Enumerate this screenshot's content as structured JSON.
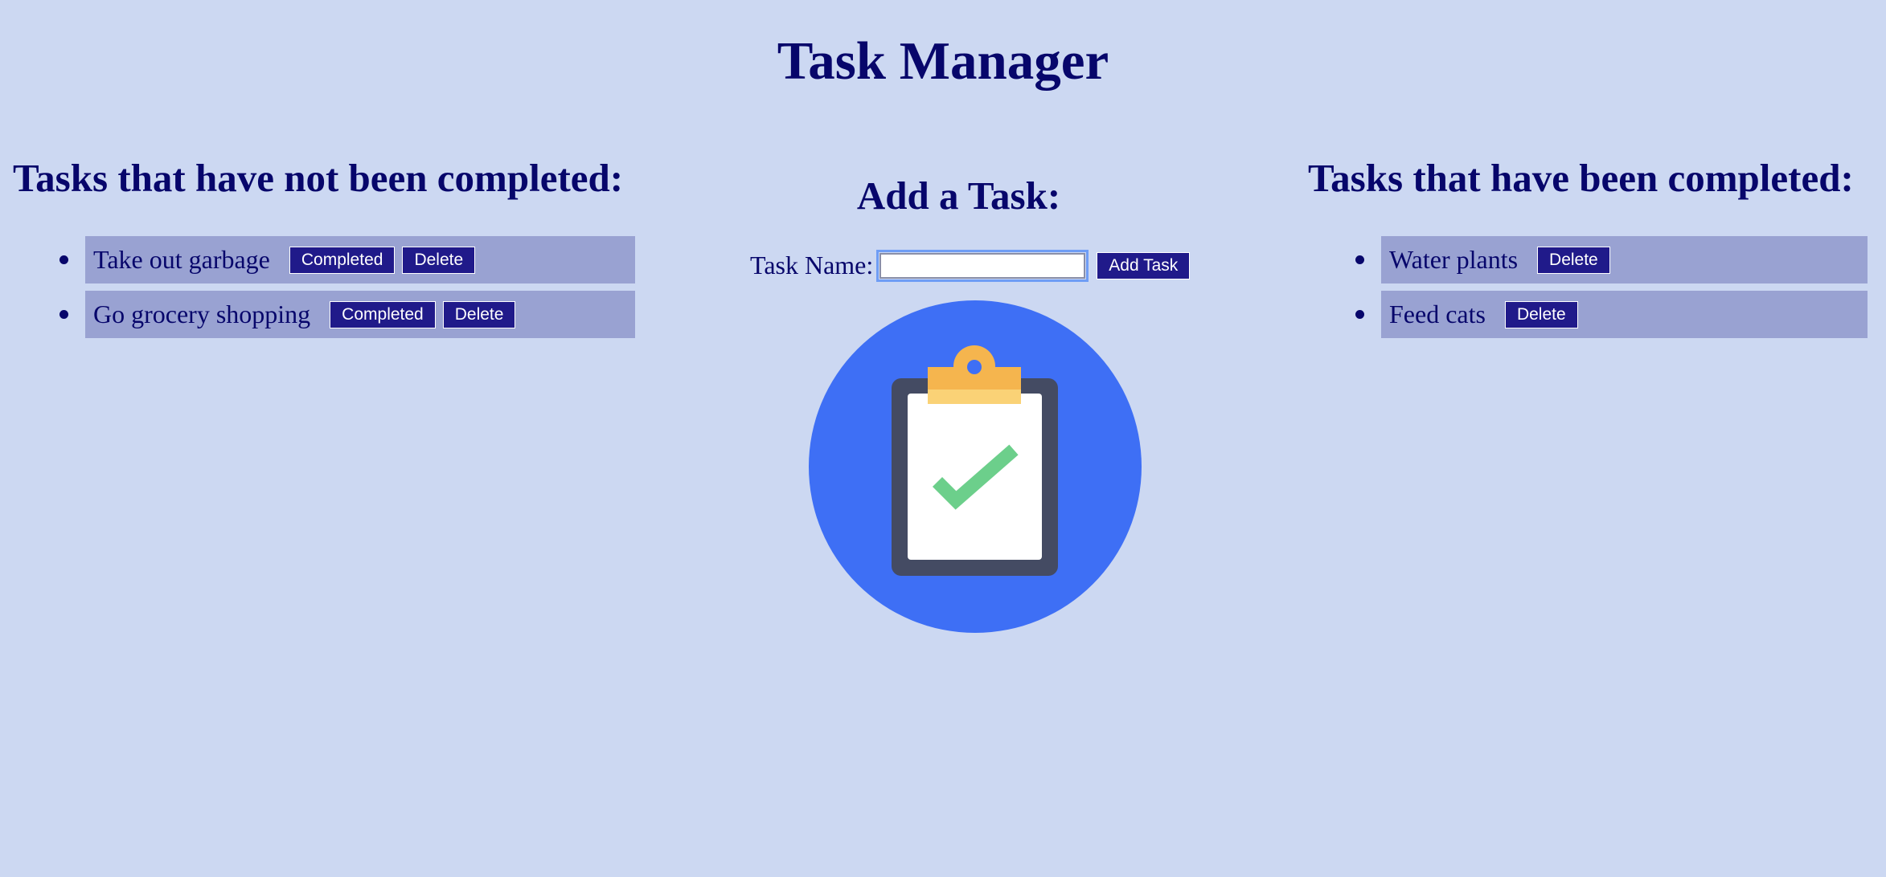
{
  "header": {
    "title": "Task Manager"
  },
  "incomplete": {
    "heading": "Tasks that have not been completed:",
    "tasks": [
      {
        "name": "Take out garbage",
        "complete_label": "Completed",
        "delete_label": "Delete"
      },
      {
        "name": "Go grocery shopping",
        "complete_label": "Completed",
        "delete_label": "Delete"
      }
    ]
  },
  "add_task": {
    "heading": "Add a Task:",
    "field_label": "Task Name:",
    "field_value": "",
    "button_label": "Add Task"
  },
  "complete": {
    "heading": "Tasks that have been completed:",
    "tasks": [
      {
        "name": "Water plants",
        "delete_label": "Delete"
      },
      {
        "name": "Feed cats",
        "delete_label": "Delete"
      }
    ]
  },
  "illustration": {
    "icon": "clipboard-check-icon"
  },
  "colors": {
    "background": "#ccd8f2",
    "text": "#07066b",
    "task_row": "#99a2d2",
    "button": "#201a8a",
    "circle": "#3e6ff5",
    "clipboard_board": "#444b63",
    "clip": "#f5b54e",
    "check": "#6ccf8b"
  }
}
